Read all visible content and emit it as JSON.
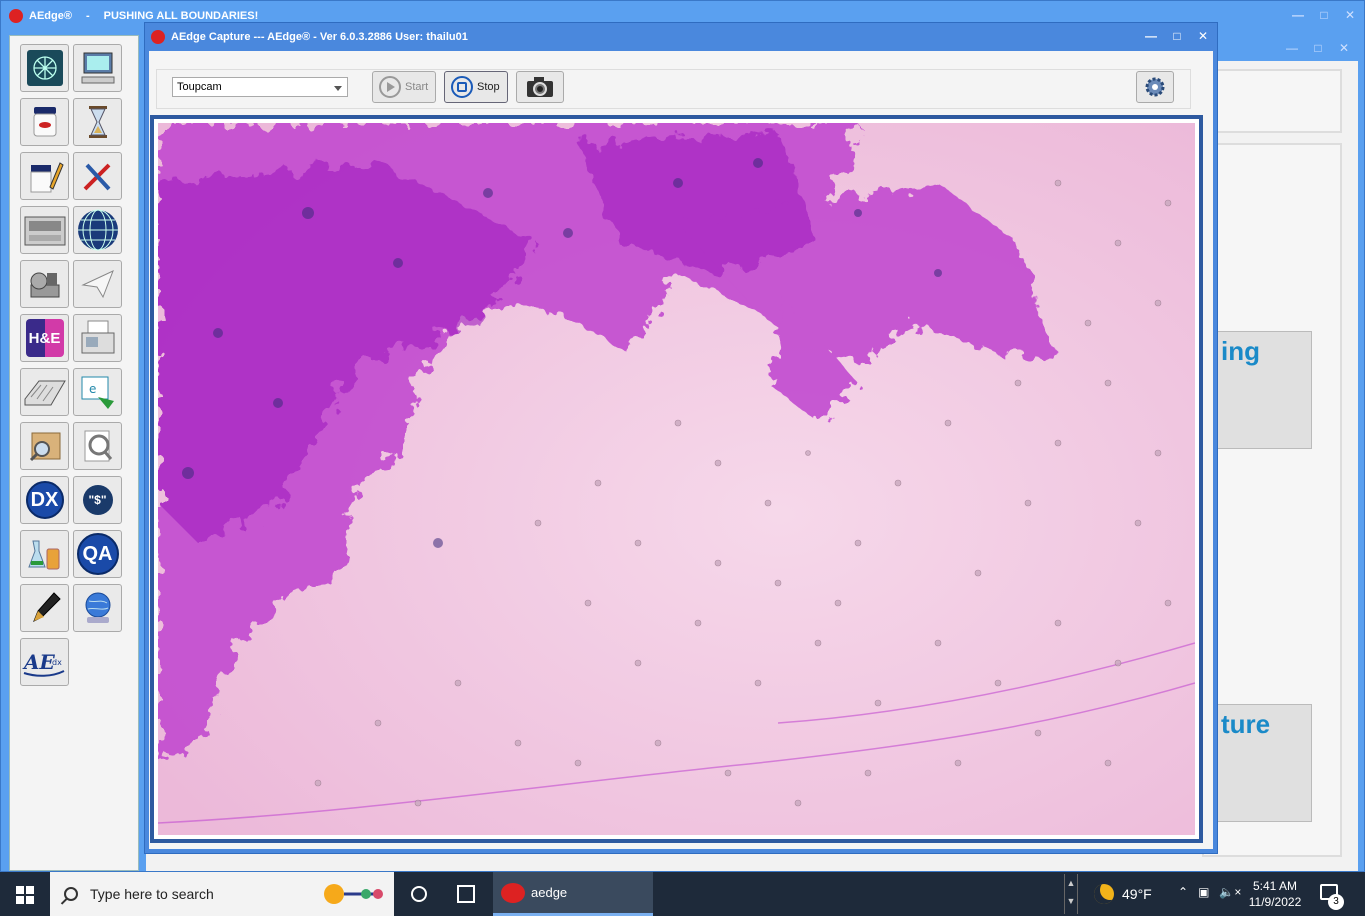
{
  "main_window": {
    "app_name": "AEdge®",
    "separator": "-",
    "tagline": "PUSHING ALL BOUNDARIES!"
  },
  "left_toolbar": {
    "icons": [
      "network-icon",
      "computer-icon",
      "specimen-jar-icon",
      "hourglass-icon",
      "jar-pencil-icon",
      "tools-icon",
      "processor-machine-icon",
      "globe-icon",
      "microtome-icon",
      "paper-plane-icon",
      "he-stain-icon",
      "fax-machine-icon",
      "keyboard-icon",
      "e-send-icon",
      "magnifier-folder-icon",
      "search-document-icon",
      "dx-icon",
      "dollar-icon",
      "lab-flasks-icon",
      "qa-icon",
      "pen-icon",
      "globe-network-icon",
      "aedge-dx-logo-icon"
    ],
    "dx_label": "DX",
    "qa_label": "QA",
    "dollar_label": "\"$\"",
    "he_label": "H&E"
  },
  "background_panel": {
    "button1_partial": "ing",
    "button2_partial": "ture"
  },
  "capture_dialog": {
    "title": "AEdge Capture --- AEdge® -  Ver 6.0.3.2886  User: thailu01",
    "camera_select_value": "Toupcam",
    "start_label": "Start",
    "stop_label": "Stop"
  },
  "taskbar": {
    "search_placeholder": "Type here to search",
    "app_label": "aedge",
    "weather_temp": "49°F",
    "time": "5:41 AM",
    "date": "11/9/2022",
    "notification_count": "3"
  },
  "colors": {
    "title_blue": "#5aa0f0",
    "dialog_blue": "#4a88dd",
    "frame_blue": "#2e5aa0",
    "accent_text": "#1a8ac8",
    "taskbar": "#1e2a3a",
    "stain_pink": "#f2c6e4",
    "stain_magenta": "#b431c8"
  }
}
